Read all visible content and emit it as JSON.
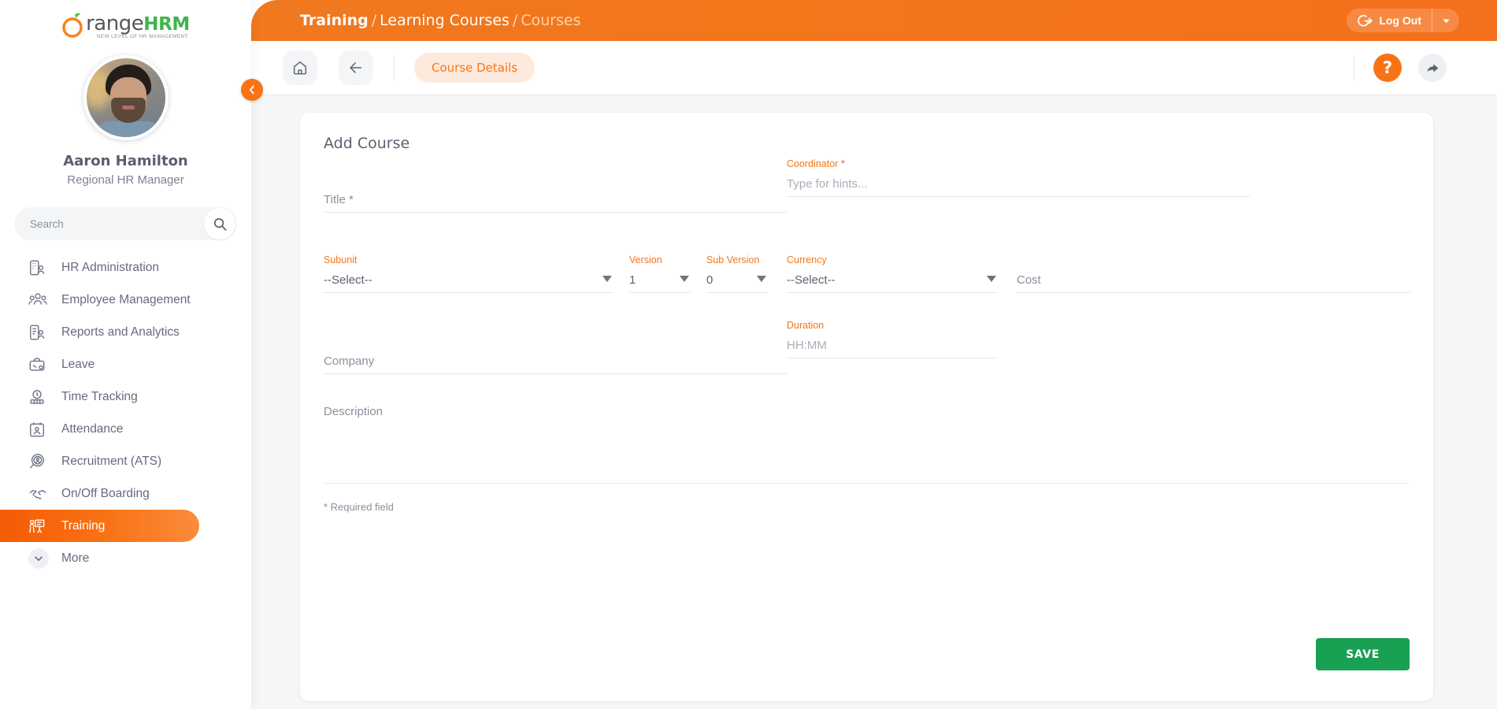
{
  "brand": {
    "name_left": "range",
    "name_o": "O",
    "name_right": "HRM",
    "tagline": "NEW LEVEL OF HR MANAGEMENT"
  },
  "sidebar": {
    "user_name": "Aaron Hamilton",
    "user_role": "Regional HR Manager",
    "search_placeholder": "Search",
    "search_value": "",
    "items": [
      {
        "label": "HR Administration",
        "icon": "hr-administration-icon",
        "active": false
      },
      {
        "label": "Employee Management",
        "icon": "employee-management-icon",
        "active": false
      },
      {
        "label": "Reports and Analytics",
        "icon": "reports-analytics-icon",
        "active": false
      },
      {
        "label": "Leave",
        "icon": "leave-icon",
        "active": false
      },
      {
        "label": "Time Tracking",
        "icon": "time-tracking-icon",
        "active": false
      },
      {
        "label": "Attendance",
        "icon": "attendance-icon",
        "active": false
      },
      {
        "label": "Recruitment (ATS)",
        "icon": "recruitment-icon",
        "active": false
      },
      {
        "label": "On/Off Boarding",
        "icon": "onoff-boarding-icon",
        "active": false
      },
      {
        "label": "Training",
        "icon": "training-icon",
        "active": true
      },
      {
        "label": "More",
        "icon": "chevron-down-icon",
        "active": false
      }
    ],
    "collapse_icon": "chevron-left-icon"
  },
  "topbar": {
    "breadcrumb": {
      "module": "Training",
      "section": "Learning Courses",
      "page": "Courses",
      "separator": "/"
    },
    "logout_label": "Log Out",
    "logout_icon": "logout-icon",
    "logout_caret_icon": "chevron-down-icon"
  },
  "actionbar": {
    "home_icon": "home-icon",
    "back_icon": "arrow-left-icon",
    "tab_label": "Course Details",
    "help_label": "?",
    "help_icon": "help-icon",
    "share_icon": "share-icon"
  },
  "form": {
    "title": "Add Course",
    "fields": {
      "title": {
        "label": "Title",
        "required_mark": "*",
        "placeholder": "Title *",
        "value": ""
      },
      "coordinator": {
        "label": "Coordinator",
        "required_mark": "*",
        "placeholder": "Type for hints...",
        "value": ""
      },
      "subunit": {
        "label": "Subunit",
        "value": "--Select--"
      },
      "version": {
        "label": "Version",
        "value": "1"
      },
      "sub_version": {
        "label": "Sub Version",
        "value": "0"
      },
      "currency": {
        "label": "Currency",
        "value": "--Select--"
      },
      "cost": {
        "label": "Cost",
        "placeholder": "Cost",
        "value": ""
      },
      "company": {
        "label": "Company",
        "placeholder": "Company",
        "value": ""
      },
      "duration": {
        "label": "Duration",
        "placeholder": "HH:MM",
        "value": ""
      },
      "description": {
        "label": "Description",
        "placeholder": "Description",
        "value": ""
      }
    },
    "required_note": "* Required field",
    "save_label": "SAVE"
  },
  "colors": {
    "brand_orange": "#f4761b",
    "accent_orange": "#f97316",
    "save_green": "#1aa053",
    "label_orange": "#f4761b",
    "text_gray": "#5c6170"
  }
}
